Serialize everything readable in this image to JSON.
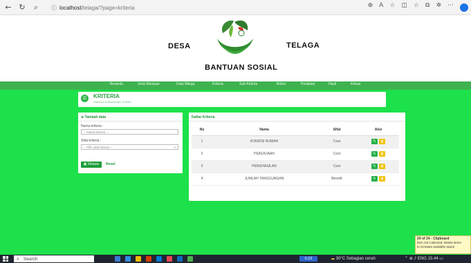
{
  "browser": {
    "url_host": "localhost",
    "url_path": "/telaga/?page=kriteria",
    "icons": [
      "back-icon",
      "refresh-icon",
      "search-icon",
      "info-icon",
      "zoom-icon",
      "read-aloud-icon",
      "favorite-icon",
      "split-screen-icon",
      "favorites-bar-icon",
      "collections-icon",
      "extensions-icon",
      "more-icon",
      "profile-icon"
    ]
  },
  "header": {
    "brand_left": "DESA",
    "brand_right": "TELAGA",
    "brand_sub": "BANTUAN SOSIAL"
  },
  "nav": {
    "items": [
      "Beranda",
      "Jenis Bantuan",
      "Data Warga",
      "Kriteria",
      "Sub Kriteria",
      "Bobot",
      "Penilaian",
      "Hasil",
      "Keluar"
    ]
  },
  "page": {
    "title": "KRITERIA",
    "subtitle": "Halaman Administrator Kriteria"
  },
  "form": {
    "heading": "Tambah data",
    "nama_label": "Nama kriteria :",
    "nama_placeholder": "-- Nama kriteria --",
    "sifat_label": "Sifat kriteria :",
    "sifat_selected": "-- Pilih sifat kriteria --",
    "save_label": "Simpan",
    "reset_label": "Reset"
  },
  "table": {
    "heading": "Daftar Kriteria",
    "columns": [
      "No",
      "Nama",
      "Sifat",
      "Aksi"
    ],
    "rows": [
      {
        "no": "1",
        "nama": "KONDISI RUMAH",
        "sifat": "Cost"
      },
      {
        "no": "2",
        "nama": "PEKERJAAN",
        "sifat": "Cost"
      },
      {
        "no": "3",
        "nama": "PENGHASILAN",
        "sifat": "Cost"
      },
      {
        "no": "4",
        "nama": "JUMLAH TANGGUNGAN",
        "sifat": "Benefit"
      }
    ]
  },
  "toast": {
    "title": "24 of 24 - Clipboard",
    "line1": "Item not Collected: Delete items",
    "line2": "to increase available space"
  },
  "taskbar": {
    "search": "Search",
    "badge": "0.23",
    "weather": "30°C  Sebagian cerah",
    "lang": "ENG",
    "time": "15.44"
  },
  "colors": {
    "nav_green": "#3fb14f",
    "content_green": "#1de14a",
    "edit_button": "#27b14a",
    "delete_button": "#f1c40f"
  }
}
